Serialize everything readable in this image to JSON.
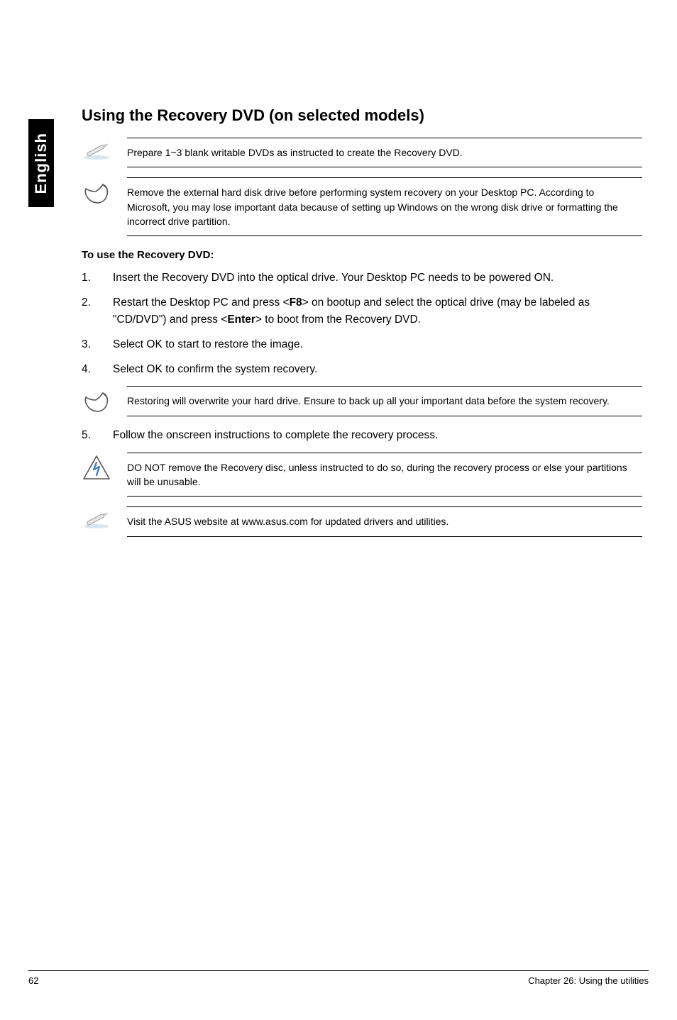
{
  "sidebar": {
    "language": "English"
  },
  "heading": "Using the Recovery DVD (on selected models)",
  "callouts": {
    "note1": "Prepare 1~3 blank writable DVDs as instructed to create the Recovery DVD.",
    "hand1": "Remove the external hard disk drive before performing system recovery on your Desktop PC. According to Microsoft, you may lose important data because of setting up Windows on the wrong disk drive or formatting the incorrect drive partition.",
    "hand2": "Restoring will overwrite your hard drive. Ensure to back up all your important data before the system recovery.",
    "warn": "DO NOT remove the Recovery disc, unless instructed to do so, during the recovery process or else your partitions will be unusable.",
    "note2": "Visit the ASUS website at www.asus.com for updated drivers and utilities."
  },
  "subhead": "To use the Recovery DVD:",
  "steps": [
    {
      "n": "1.",
      "text": "Insert the Recovery DVD into the optical drive. Your Desktop PC needs to be powered ON."
    },
    {
      "n": "2.",
      "pre": "Restart the Desktop PC and press <",
      "k1": "F8",
      "mid": "> on bootup and select the optical drive (may be labeled as \"CD/DVD\") and press <",
      "k2": "Enter",
      "post": "> to boot from the Recovery DVD."
    },
    {
      "n": "3.",
      "text": "Select OK to start to restore the image."
    },
    {
      "n": "4.",
      "text": "Select OK to confirm the system recovery."
    },
    {
      "n": "5.",
      "text": "Follow the onscreen instructions to complete the recovery process."
    }
  ],
  "footer": {
    "page": "62",
    "chapter": "Chapter 26: Using the utilities"
  }
}
